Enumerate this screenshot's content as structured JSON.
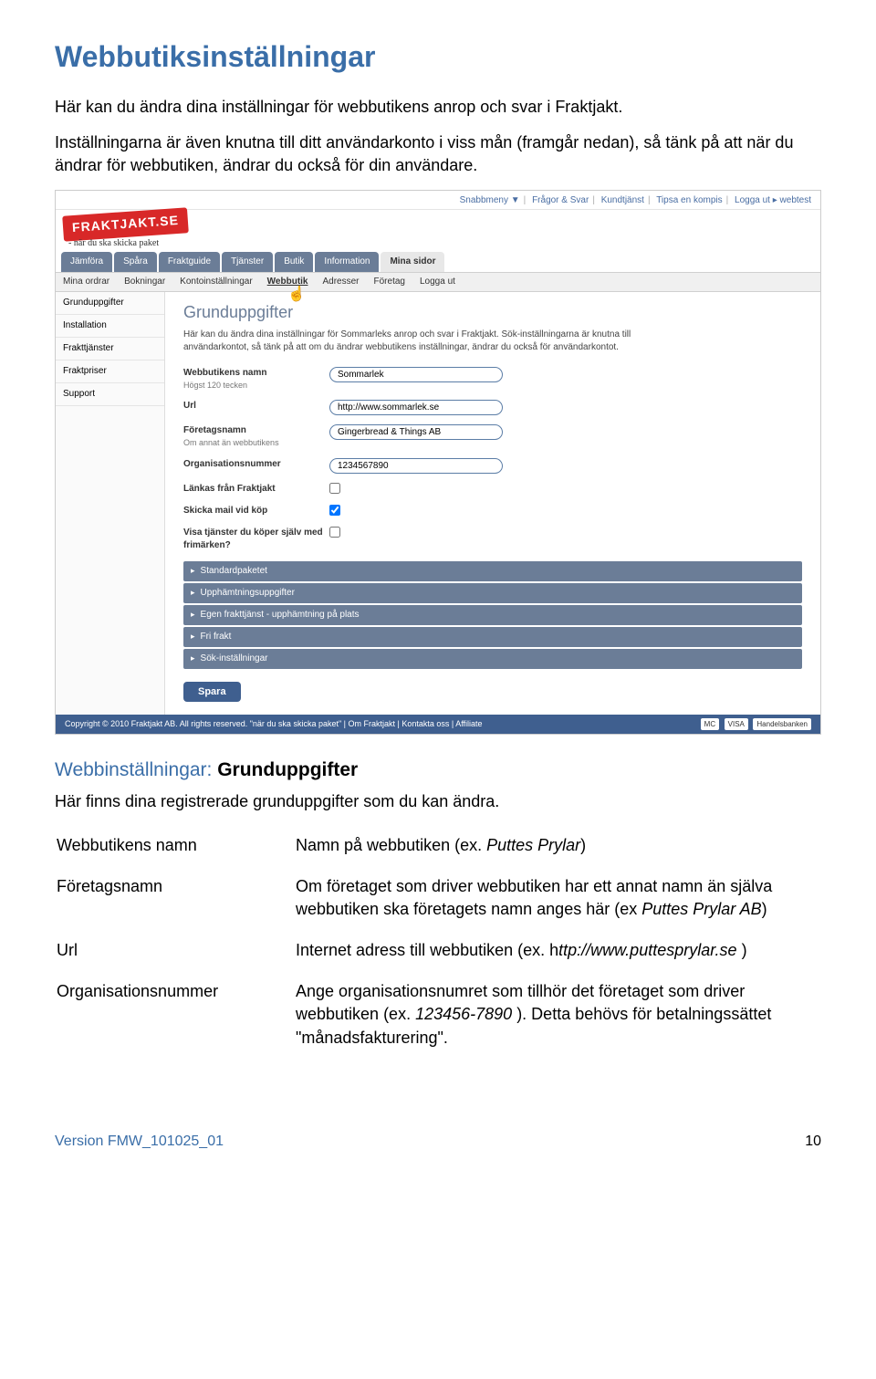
{
  "title": "Webbutiksinställningar",
  "intro1": "Här kan du ändra dina inställningar för webbutikens anrop och svar i Fraktjakt.",
  "intro2": "Inställningarna är även knutna till ditt användarkonto i viss mån (framgår nedan), så tänk på att när du ändrar för webbutiken, ändrar du också för din användare.",
  "screenshot": {
    "toplinks": [
      "Snabbmeny ▼",
      "Frågor & Svar",
      "Kundtjänst",
      "Tipsa en kompis",
      "Logga ut ▸",
      "webtest"
    ],
    "logo": "FRAKTJAKT.SE",
    "tagline": "- när du ska skicka paket",
    "mainnav": [
      "Jämföra",
      "Spåra",
      "Fraktguide",
      "Tjänster",
      "Butik",
      "Information",
      "Mina sidor"
    ],
    "mainnav_active": 6,
    "subnav": [
      "Mina ordrar",
      "Bokningar",
      "Kontoinställningar",
      "Webbutik",
      "Adresser",
      "Företag",
      "Logga ut"
    ],
    "subnav_active": 3,
    "sidebar": [
      "Grunduppgifter",
      "Installation",
      "Frakttjänster",
      "Fraktpriser",
      "Support"
    ],
    "content_title": "Grunduppgifter",
    "content_desc": "Här kan du ändra dina inställningar för Sommarleks anrop och svar i Fraktjakt. Sök-inställningarna är knutna till användarkontot, så tänk på att om du ändrar webbutikens inställningar, ändrar du också för användarkontot.",
    "form": {
      "name_label": "Webbutikens namn",
      "name_hint": "Högst 120 tecken",
      "name_value": "Sommarlek",
      "url_label": "Url",
      "url_value": "http://www.sommarlek.se",
      "company_label": "Företagsnamn",
      "company_hint": "Om annat än webbutikens",
      "company_value": "Gingerbread & Things AB",
      "orgnr_label": "Organisationsnummer",
      "orgnr_value": "1234567890",
      "link_label": "Länkas från Fraktjakt",
      "mail_label": "Skicka mail vid köp",
      "show_label": "Visa tjänster du köper själv med frimärken?"
    },
    "accordions": [
      "Standardpaketet",
      "Upphämtningsuppgifter",
      "Egen frakttjänst - upphämtning på plats",
      "Fri frakt",
      "Sök-inställningar"
    ],
    "save": "Spara",
    "footer_left": "Copyright © 2010 Fraktjakt AB. All rights reserved. \"när du ska skicka paket\"  |  Om Fraktjakt  |  Kontakta oss  |  Affiliate",
    "footer_cards": [
      "MC",
      "VISA",
      "Handelsbanken"
    ]
  },
  "section": {
    "blue": "Webbinställningar: ",
    "black": "Grunduppgifter",
    "sub": "Här finns dina registrerade grunduppgifter som du kan ändra.",
    "rows": [
      {
        "term": "Webbutikens namn",
        "desc": "Namn på webbutiken (ex. <it>Puttes Prylar</it>)"
      },
      {
        "term": "Företagsnamn",
        "desc": "Om företaget som driver webbutiken har ett annat namn än själva webbutiken ska företagets namn anges här (ex <it>Puttes Prylar AB</it>)"
      },
      {
        "term": "Url",
        "desc": "Internet adress till webbutiken (ex. h<it>ttp://www.puttesprylar.se</it> )"
      },
      {
        "term": "Organisationsnummer",
        "desc": "Ange organisationsnumret som tillhör det företaget som driver webbutiken (ex. <it>123456-7890</it> ). Detta behövs för betalningssättet \"månadsfakturering\"."
      }
    ]
  },
  "footer": {
    "version": "Version FMW_101025_01",
    "page": "10"
  }
}
